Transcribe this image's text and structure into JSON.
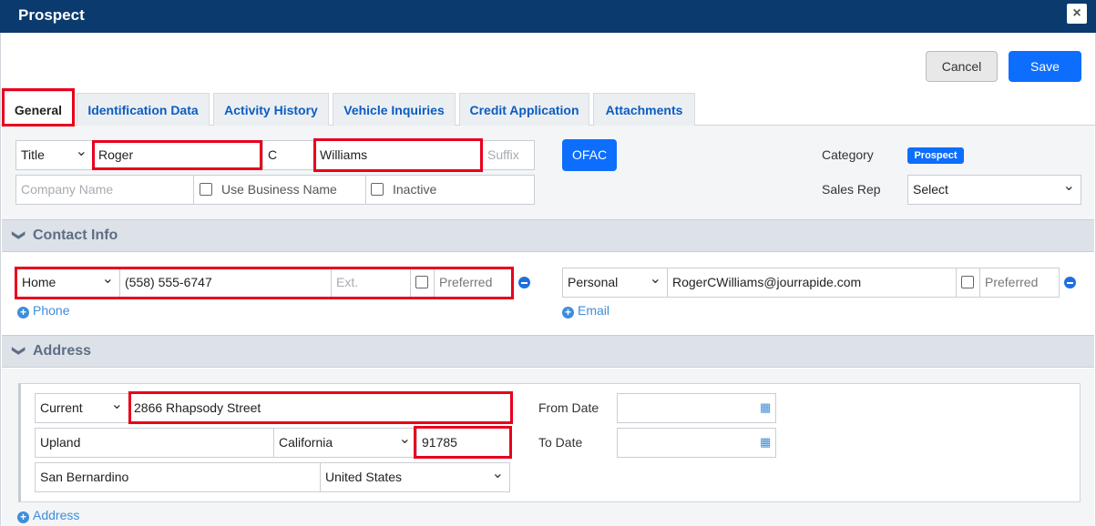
{
  "dialog": {
    "title": "Prospect",
    "close_glyph": "×"
  },
  "actions": {
    "cancel": "Cancel",
    "save": "Save"
  },
  "tabs": [
    {
      "label": "General",
      "active": true
    },
    {
      "label": "Identification Data"
    },
    {
      "label": "Activity History"
    },
    {
      "label": "Vehicle Inquiries"
    },
    {
      "label": "Credit Application"
    },
    {
      "label": "Attachments"
    }
  ],
  "general": {
    "title_select": "Title",
    "first_name": "Roger",
    "middle_initial": "C",
    "last_name": "Williams",
    "suffix_placeholder": "Suffix",
    "company_placeholder": "Company Name",
    "use_business_name_label": "Use Business Name",
    "inactive_label": "Inactive",
    "ofac_button": "OFAC",
    "category_label": "Category",
    "category_badge": "Prospect",
    "sales_rep_label": "Sales Rep",
    "sales_rep_value": "Select"
  },
  "contact": {
    "section_title": "Contact Info",
    "phone": {
      "type": "Home",
      "number": "(558) 555-6747",
      "ext_placeholder": "Ext.",
      "preferred_label": "Preferred"
    },
    "email": {
      "type": "Personal",
      "address": "RogerCWilliams@jourrapide.com",
      "preferred_label": "Preferred"
    },
    "add_phone": "Phone",
    "add_email": "Email"
  },
  "address": {
    "section_title": "Address",
    "type": "Current",
    "street": "2866 Rhapsody Street",
    "city": "Upland",
    "state": "California",
    "zip": "91785",
    "county": "San Bernardino",
    "country": "United States",
    "from_date_label": "From Date",
    "to_date_label": "To Date",
    "add_address": "Address"
  },
  "colors": {
    "header": "#0b3a6e",
    "accent": "#0d6efd",
    "highlight": "#e8001c"
  }
}
